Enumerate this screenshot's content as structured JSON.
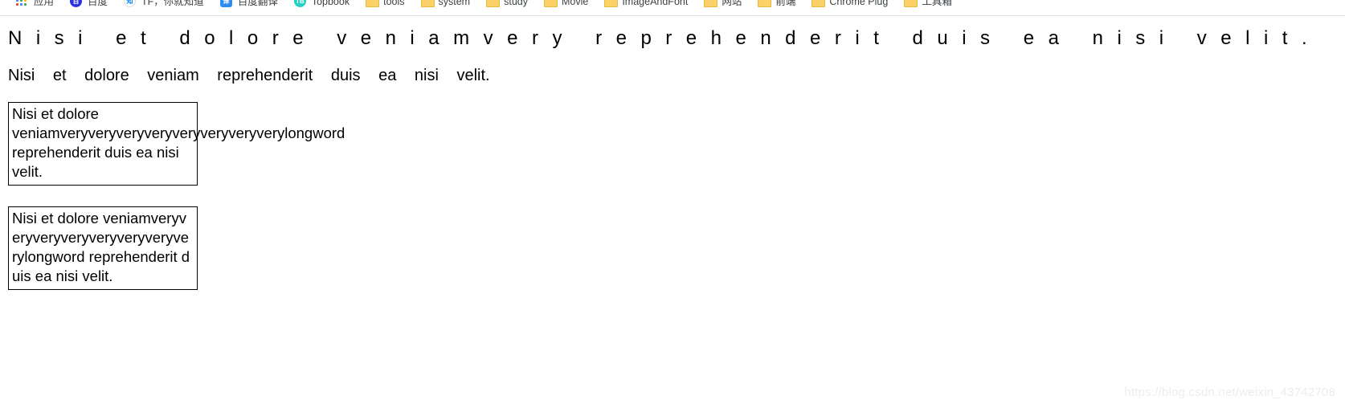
{
  "browser": {
    "bookmarks_bar": {
      "items": [
        {
          "label": "应用",
          "icon": "apps-grid-icon",
          "icon_text": ""
        },
        {
          "label": "百度",
          "icon": "baidu-favicon",
          "icon_text": "百"
        },
        {
          "label": "TF，你就知道",
          "icon": "zhihu-favicon",
          "icon_text": "知"
        },
        {
          "label": "百度翻译",
          "icon": "fanyi-favicon",
          "icon_text": "译"
        },
        {
          "label": "Topbook",
          "icon": "topbook-favicon",
          "icon_text": "TB"
        },
        {
          "label": "tools",
          "icon": "folder-icon",
          "icon_text": ""
        },
        {
          "label": "system",
          "icon": "folder-icon",
          "icon_text": ""
        },
        {
          "label": "study",
          "icon": "folder-icon",
          "icon_text": ""
        },
        {
          "label": "Movie",
          "icon": "folder-icon",
          "icon_text": ""
        },
        {
          "label": "ImageAndFont",
          "icon": "folder-icon",
          "icon_text": ""
        },
        {
          "label": "网站",
          "icon": "folder-icon",
          "icon_text": ""
        },
        {
          "label": "前端",
          "icon": "folder-icon",
          "icon_text": ""
        },
        {
          "label": "Chrome Plug",
          "icon": "folder-icon",
          "icon_text": ""
        },
        {
          "label": "工具箱",
          "icon": "folder-icon",
          "icon_text": ""
        }
      ]
    }
  },
  "page": {
    "heading_justified": "Nisi et dolore veniamvery reprehenderit duis ea nisi velit.",
    "paragraph_spaced": "Nisi et dolore veniam reprehenderit duis ea nisi velit.",
    "boxes": [
      {
        "name": "overflow-box",
        "text": "Nisi et dolore veniamveryveryveryveryveryveryveryverylongword reprehenderit duis ea nisi velit."
      },
      {
        "name": "break-all-box",
        "text": "Nisi et dolore veniamveryveryveryveryveryveryveryverylongword reprehenderit duis ea nisi velit."
      }
    ],
    "watermark": "https://blog.csdn.net/weixin_43742708"
  },
  "colors": {
    "text": "#000000",
    "border": "#000000",
    "watermark": "#ededed",
    "bar_divider": "#e0e0e0",
    "folder": "#fbd268"
  }
}
